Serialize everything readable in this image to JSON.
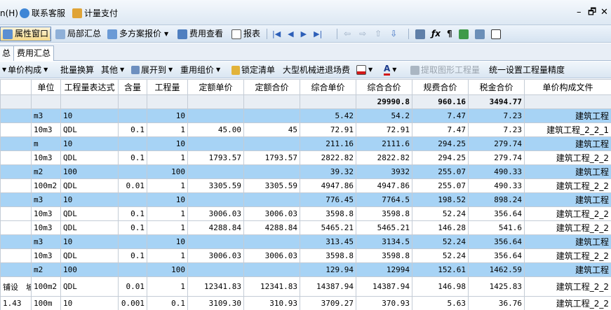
{
  "menubar": {
    "help": "n(H)",
    "support": "联系客服",
    "pay": "计量支付"
  },
  "toolbar1": {
    "attr_window": "属性窗口",
    "local_summary": "局部汇总",
    "multi_quote": "多方案报价",
    "fee_view": "费用查看",
    "report": "报表"
  },
  "tabs": [
    {
      "label": "总"
    },
    {
      "label": "费用汇总"
    }
  ],
  "toolbar2": {
    "unit_price_comp": "单价构成",
    "batch_convert": "批量换算",
    "other": "其他",
    "expand_to": "展开到",
    "reuse_price": "重用组价",
    "lock_list": "锁定清单",
    "machinery_fee": "大型机械进退场费",
    "extract_qty": "提取图形工程量",
    "set_precision": "统一设置工程量精度"
  },
  "table": {
    "headers": [
      "",
      "单位",
      "工程量表达式",
      "含量",
      "工程量",
      "定额单价",
      "定额合价",
      "综合单价",
      "综合合价",
      "规费合价",
      "税金合价",
      "单价构成文件"
    ],
    "summary": [
      "",
      "",
      "",
      "",
      "",
      "",
      "",
      "",
      "29990.8",
      "960.16",
      "3494.77",
      ""
    ],
    "rows": [
      {
        "kind": "grp",
        "cells": [
          "",
          "m3",
          "10",
          "",
          "10",
          "",
          "",
          "5.42",
          "54.2",
          "7.47",
          "7.23",
          "建筑工程"
        ]
      },
      {
        "kind": "sub",
        "cells": [
          "",
          "10m3",
          "QDL",
          "0.1",
          "1",
          "45.00",
          "45",
          "72.91",
          "72.91",
          "7.47",
          "7.23",
          "建筑工程_2_2_1"
        ]
      },
      {
        "kind": "grp",
        "cells": [
          "",
          "m",
          "10",
          "",
          "10",
          "",
          "",
          "211.16",
          "2111.6",
          "294.25",
          "279.74",
          "建筑工程"
        ]
      },
      {
        "kind": "sub",
        "cells": [
          "",
          "10m3",
          "QDL",
          "0.1",
          "1",
          "1793.57",
          "1793.57",
          "2822.82",
          "2822.82",
          "294.25",
          "279.74",
          "建筑工程_2_2"
        ]
      },
      {
        "kind": "grp",
        "cells": [
          "",
          "m2",
          "100",
          "",
          "100",
          "",
          "",
          "39.32",
          "3932",
          "255.07",
          "490.33",
          "建筑工程"
        ]
      },
      {
        "kind": "sub",
        "cells": [
          "",
          "100m2",
          "QDL",
          "0.01",
          "1",
          "3305.59",
          "3305.59",
          "4947.86",
          "4947.86",
          "255.07",
          "490.33",
          "建筑工程_2_2"
        ]
      },
      {
        "kind": "grp",
        "cells": [
          "",
          "m3",
          "10",
          "",
          "10",
          "",
          "",
          "776.45",
          "7764.5",
          "198.52",
          "898.24",
          "建筑工程"
        ]
      },
      {
        "kind": "sub",
        "cells": [
          "",
          "10m3",
          "QDL",
          "0.1",
          "1",
          "3006.03",
          "3006.03",
          "3598.8",
          "3598.8",
          "52.24",
          "356.64",
          "建筑工程_2_2"
        ]
      },
      {
        "kind": "sub",
        "cells": [
          "",
          "10m3",
          "QDL",
          "0.1",
          "1",
          "4288.84",
          "4288.84",
          "5465.21",
          "5465.21",
          "146.28",
          "541.6",
          "建筑工程_2_2"
        ]
      },
      {
        "kind": "grp",
        "cells": [
          "",
          "m3",
          "10",
          "",
          "10",
          "",
          "",
          "313.45",
          "3134.5",
          "52.24",
          "356.64",
          "建筑工程"
        ]
      },
      {
        "kind": "sub",
        "cells": [
          "",
          "10m3",
          "QDL",
          "0.1",
          "1",
          "3006.03",
          "3006.03",
          "3598.8",
          "3598.8",
          "52.24",
          "356.64",
          "建筑工程_2_2"
        ]
      },
      {
        "kind": "grp",
        "cells": [
          "",
          "m2",
          "100",
          "",
          "100",
          "",
          "",
          "129.94",
          "12994",
          "152.61",
          "1462.59",
          "建筑工程"
        ]
      },
      {
        "kind": "tall",
        "cells": [
          "铺设　坡",
          "100m2",
          "QDL",
          "0.01",
          "1",
          "12341.83",
          "12341.83",
          "14387.94",
          "14387.94",
          "146.98",
          "1425.83",
          "建筑工程_2_2"
        ]
      },
      {
        "kind": "sub",
        "cells": [
          "1.43",
          "100m",
          "10",
          "0.001",
          "0.1",
          "3109.30",
          "310.93",
          "3709.27",
          "370.93",
          "5.63",
          "36.76",
          "建筑工程_2_2"
        ]
      }
    ]
  },
  "colors": {
    "group_row": "#a7d3f5",
    "summary_row": "#e9eef4",
    "toolbar": "#dae6f2"
  }
}
